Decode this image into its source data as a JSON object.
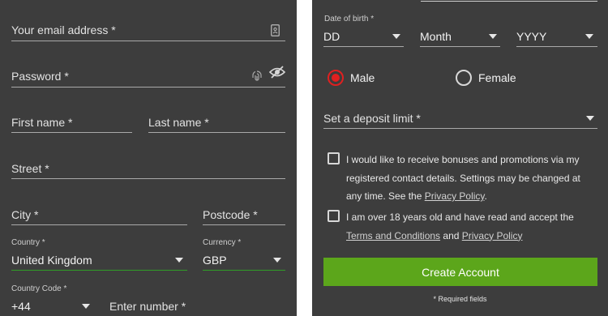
{
  "left": {
    "email": {
      "placeholder": "Your email address *",
      "icon": "contact-card-icon"
    },
    "password": {
      "placeholder": "Password *",
      "icons": [
        "fingerprint-icon",
        "eye-slash-icon"
      ]
    },
    "first_name": {
      "placeholder": "First name *"
    },
    "last_name": {
      "placeholder": "Last name *"
    },
    "street": {
      "placeholder": "Street *"
    },
    "city": {
      "placeholder": "City *"
    },
    "postcode": {
      "placeholder": "Postcode *"
    },
    "country": {
      "label": "Country *",
      "value": "United Kingdom"
    },
    "currency": {
      "label": "Currency *",
      "value": "GBP"
    },
    "country_code": {
      "label": "Country Code *",
      "value": "+44"
    },
    "phone": {
      "placeholder": "Enter number *"
    }
  },
  "right": {
    "dob": {
      "label": "Date of birth *",
      "day": "DD",
      "month": "Month",
      "year": "YYYY"
    },
    "gender": {
      "male": "Male",
      "female": "Female",
      "selected": "male"
    },
    "deposit_limit": {
      "placeholder": "Set a deposit limit *"
    },
    "bonus_consent": {
      "text_before": "I would like to receive bonuses and promotions via my registered contact details. Settings may be changed at any time. See the ",
      "link": "Privacy Policy",
      "text_after": ".",
      "checked": false
    },
    "age_consent": {
      "text_before": "I am over 18 years old and have read and accept the ",
      "link_terms": "Terms and Conditions",
      "text_and": " and ",
      "link_privacy": "Privacy Policy",
      "checked": false
    },
    "create_button": "Create Account",
    "required_note": "* Required fields"
  },
  "colors": {
    "panel_bg": "#3d3d3d",
    "accent_green": "#5ca61b",
    "radio_red": "#e02020",
    "underline_focus": "#2f9e27"
  }
}
